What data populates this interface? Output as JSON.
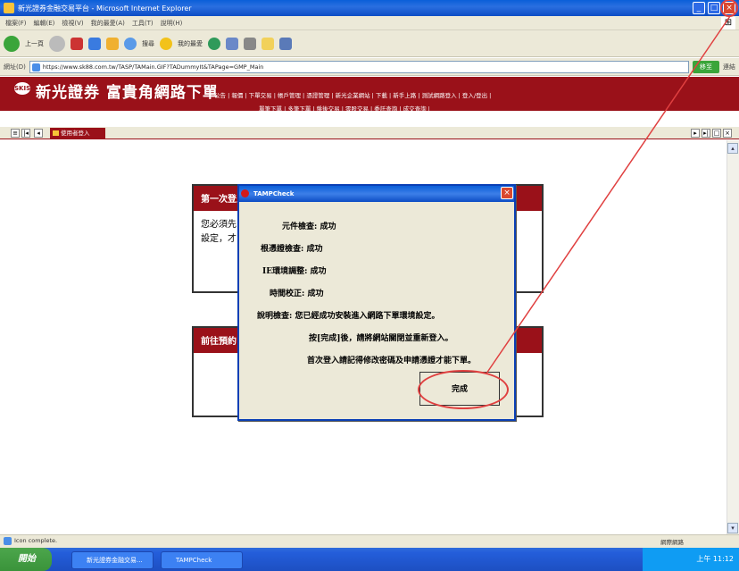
{
  "window": {
    "title": "新光證券金融交易平台 - Microsoft Internet Explorer"
  },
  "menubar": {
    "items": [
      "檔案(F)",
      "編輯(E)",
      "檢視(V)",
      "我的最愛(A)",
      "工具(T)",
      "說明(H)"
    ]
  },
  "toolbar": {
    "back_label": "上一頁",
    "search_label": "搜尋",
    "favorites_label": "我的最愛"
  },
  "address": {
    "label": "網址(D)",
    "url": "https://www.sk88.com.tw/TASP/TAMain.GIF?TADummyIt&TAPage=GMP_Main",
    "go_label": "移至",
    "links_label": "連結"
  },
  "site": {
    "logo_text": "SKIS",
    "name": "新光證券 富貴角網路下單",
    "topnav": "公告 | 報價 | 下單交易 | 帳戶管理 | 憑證管理 | 新光企業網站 | 下載 | 新手上路 | 測試網路登入 | 登入/登出 |",
    "subnav": "單筆下單 | 多筆下單 | 盤後交易 | 零股交易 | 委託查詢 | 成交查詢 |"
  },
  "tabs": {
    "active_label": "使用者登入"
  },
  "panels": {
    "first_header": "第一次登入",
    "first_body_1": "您必須先",
    "first_body_2": "設定，才",
    "second_header": "前往預約"
  },
  "dialog": {
    "title": "TAMPCheck",
    "rows": [
      "元件檢查: 成功",
      "根憑證檢查: 成功",
      "IE環境調整: 成功",
      "時間校正: 成功",
      "說明檢查: 您已經成功安裝進入網路下單環境設定。",
      "按[完成]後，請將網站關閉並重新登入。",
      "首次登入請記得修改密碼及申請憑證才能下單。"
    ],
    "done_label": "完成"
  },
  "status": {
    "text": "Icon complete.",
    "zone": "網際網路"
  },
  "taskbar": {
    "start_label": "開始",
    "item1": "新光證券金融交易...",
    "item2": "TAMPCheck",
    "clock": "上午 11:12"
  },
  "colors": {
    "brand": "#9a1119",
    "annotation": "#e04040"
  }
}
